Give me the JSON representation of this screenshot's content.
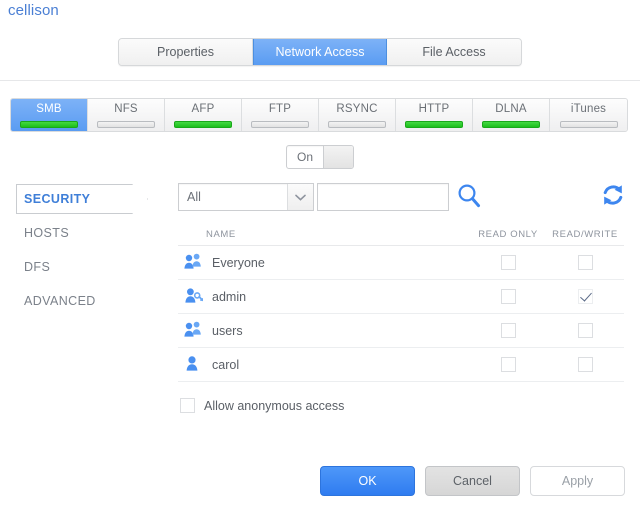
{
  "share": {
    "name": "cellison"
  },
  "main_tabs": [
    {
      "label": "Properties",
      "active": false
    },
    {
      "label": "Network Access",
      "active": true
    },
    {
      "label": "File Access",
      "active": false
    }
  ],
  "protocol_tabs": [
    {
      "label": "SMB",
      "active": true,
      "enabled": true
    },
    {
      "label": "NFS",
      "active": false,
      "enabled": false
    },
    {
      "label": "AFP",
      "active": false,
      "enabled": true
    },
    {
      "label": "FTP",
      "active": false,
      "enabled": false
    },
    {
      "label": "RSYNC",
      "active": false,
      "enabled": false
    },
    {
      "label": "HTTP",
      "active": false,
      "enabled": true
    },
    {
      "label": "DLNA",
      "active": false,
      "enabled": true
    },
    {
      "label": "iTunes",
      "active": false,
      "enabled": false
    }
  ],
  "toggle": {
    "label": "On",
    "state": "on"
  },
  "sidebar": {
    "items": [
      {
        "label": "SECURITY",
        "active": true
      },
      {
        "label": "HOSTS",
        "active": false
      },
      {
        "label": "DFS",
        "active": false
      },
      {
        "label": "ADVANCED",
        "active": false
      }
    ]
  },
  "filter": {
    "select_value": "All",
    "select_options": [
      "All"
    ],
    "search_value": "",
    "search_placeholder": "",
    "search_icon": "search-icon",
    "refresh_icon": "refresh-icon"
  },
  "table": {
    "headers": {
      "name": "NAME",
      "read_only": "READ ONLY",
      "read_write": "READ/WRITE"
    },
    "rows": [
      {
        "name": "Everyone",
        "icon": "group-icon",
        "read_only": false,
        "read_write": false
      },
      {
        "name": "admin",
        "icon": "user-key-icon",
        "read_only": false,
        "read_write": true
      },
      {
        "name": "users",
        "icon": "group-icon",
        "read_only": false,
        "read_write": false
      },
      {
        "name": "carol",
        "icon": "user-icon",
        "read_only": false,
        "read_write": false
      }
    ]
  },
  "anonymous": {
    "label": "Allow anonymous access",
    "checked": false
  },
  "footer": {
    "ok_label": "OK",
    "cancel_label": "Cancel",
    "apply_label": "Apply"
  },
  "colors": {
    "accent_blue": "#5a9cf2",
    "primary_button": "#2f7cf0",
    "enabled_green": "#1cc01b",
    "title_blue": "#4a7fd4",
    "active_side_blue": "#3f7fd8"
  }
}
